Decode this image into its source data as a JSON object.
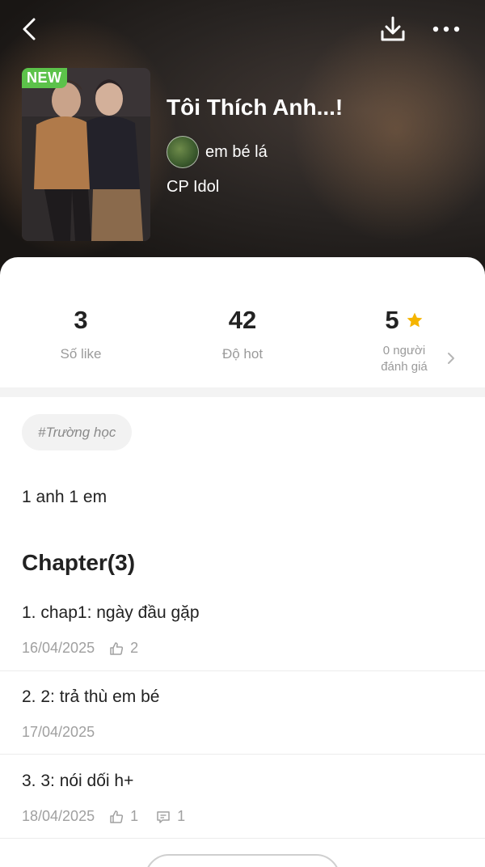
{
  "header": {
    "badge": "NEW",
    "title": "Tôi Thích Anh...!",
    "author": "em bé lá",
    "category": "CP Idol"
  },
  "stats": {
    "likes": {
      "value": "3",
      "label": "Số like"
    },
    "hot": {
      "value": "42",
      "label": "Độ hot"
    },
    "rating": {
      "value": "5",
      "label_line1": "0 người",
      "label_line2": "đánh giá"
    }
  },
  "tag": "#Trường học",
  "description": "1 anh 1 em",
  "chapters_heading": "Chapter(3)",
  "chapters": [
    {
      "title": "1. chap1: ngày đầu gặp",
      "date": "16/04/2025",
      "likes": "2",
      "comments": ""
    },
    {
      "title": "2. 2: trả thù em bé",
      "date": "17/04/2025",
      "likes": "",
      "comments": ""
    },
    {
      "title": "3. 3: nói dối h+",
      "date": "18/04/2025",
      "likes": "1",
      "comments": "1"
    }
  ],
  "colors": {
    "accent_star": "#f5b400",
    "new_badge": "#5cc24a"
  },
  "icons": [
    "back-arrow-icon",
    "download-icon",
    "more-dots-icon",
    "star-icon",
    "chevron-right-icon",
    "thumbs-up-icon",
    "comment-icon"
  ]
}
